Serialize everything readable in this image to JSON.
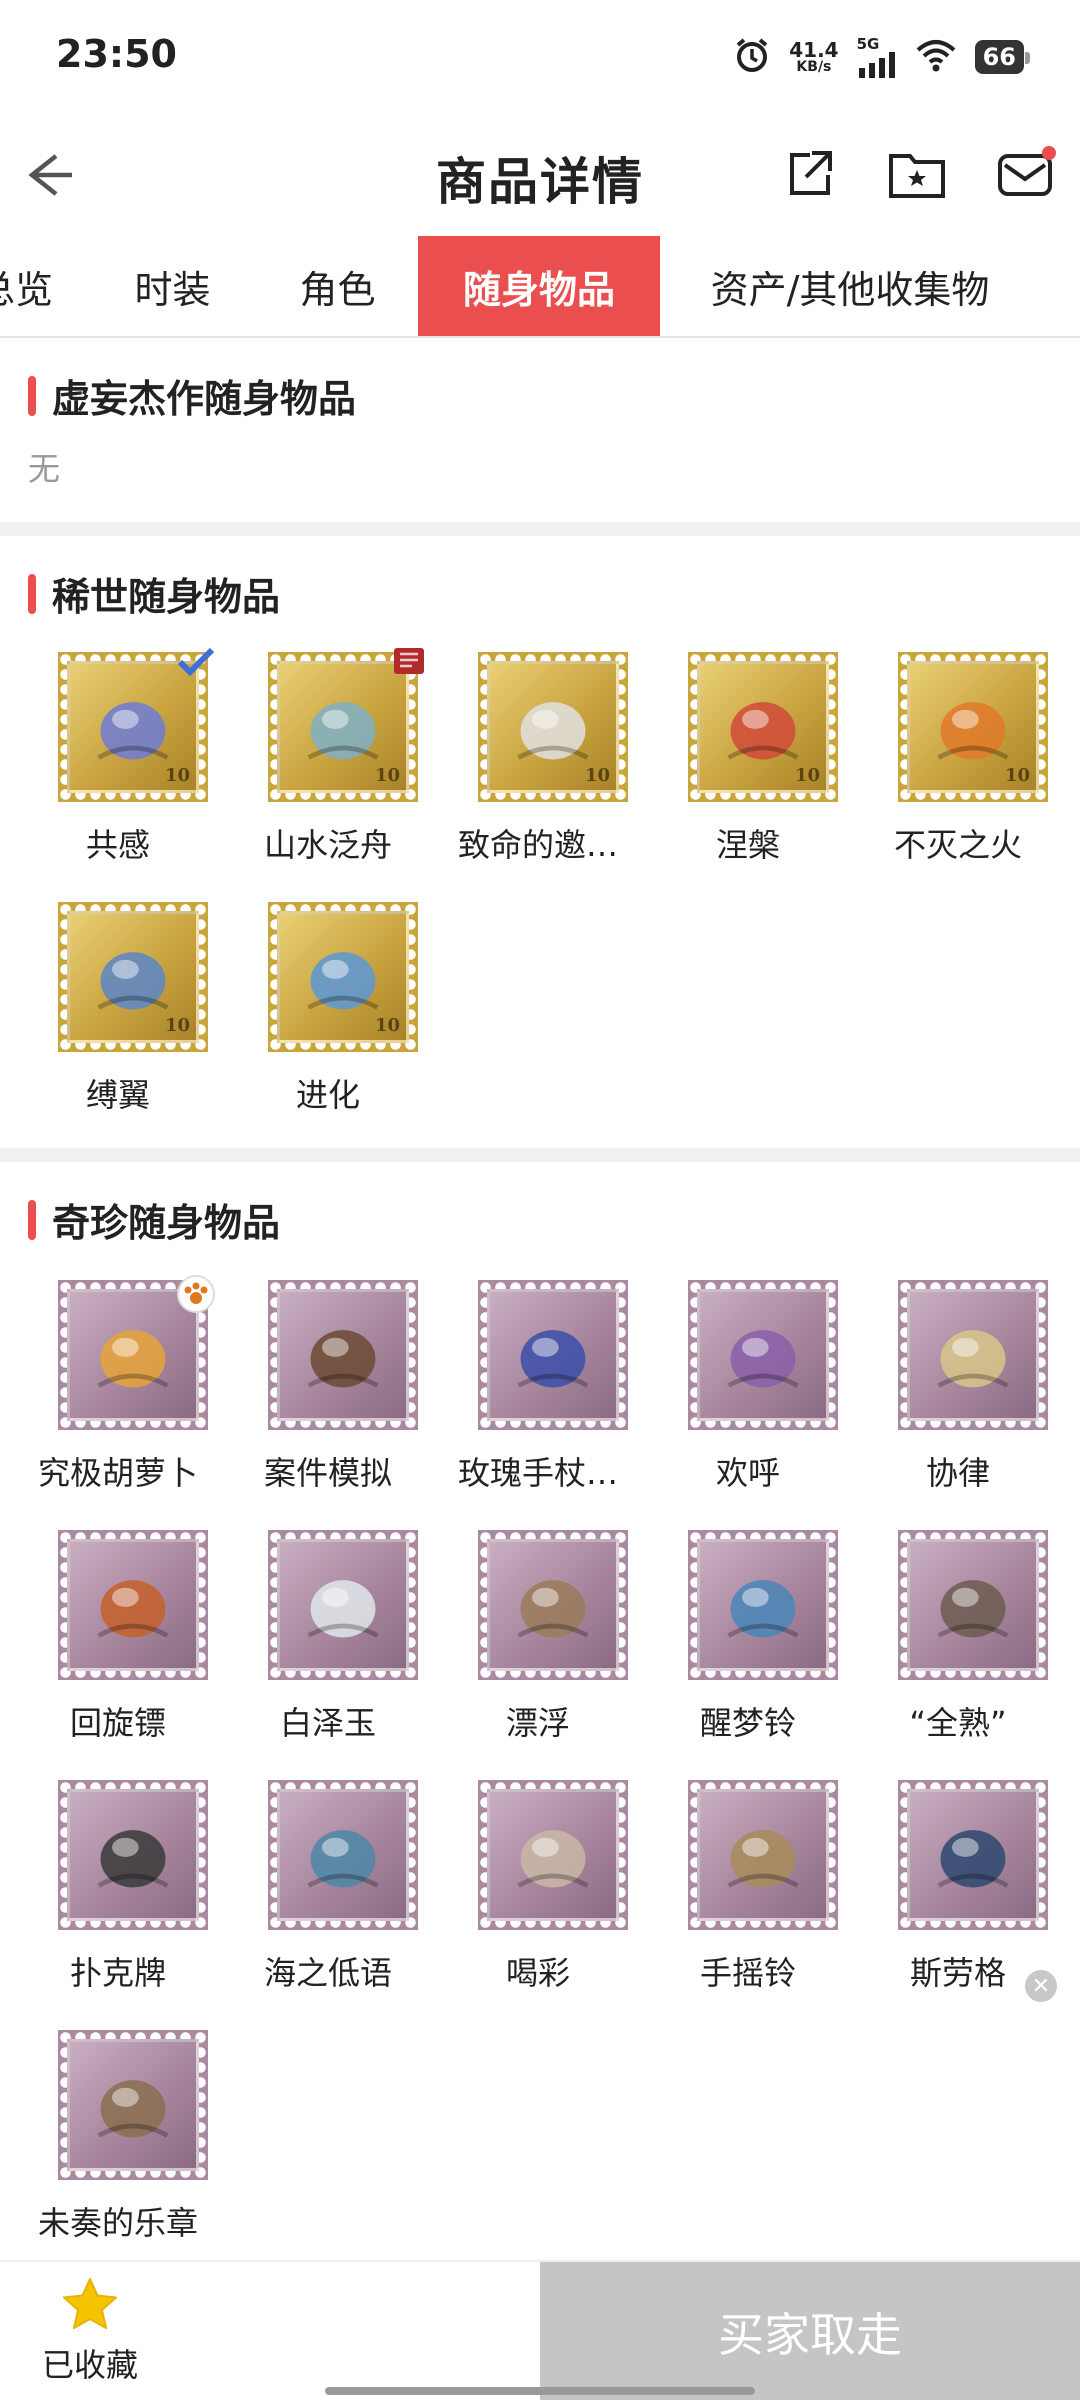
{
  "status": {
    "time": "23:50",
    "net_speed_value": "41.4",
    "net_speed_unit": "KB/s",
    "network": "5G",
    "battery": "66",
    "icons": [
      "alarm-icon",
      "signal-icon",
      "wifi-icon",
      "battery-icon"
    ]
  },
  "header": {
    "title": "商品详情",
    "icons": [
      "back-arrow-icon",
      "share-icon",
      "folder-star-icon",
      "mail-icon"
    ]
  },
  "tabs": [
    {
      "label": "总览",
      "active": false
    },
    {
      "label": "时装",
      "active": false
    },
    {
      "label": "角色",
      "active": false
    },
    {
      "label": "随身物品",
      "active": true
    },
    {
      "label": "资产/其他收集物",
      "active": false
    }
  ],
  "sections": {
    "s1": {
      "title": "虚妄杰作随身物品",
      "empty_text": "无"
    },
    "s2": {
      "title": "稀世随身物品",
      "stamp_value": "10",
      "items": [
        {
          "label": "共感",
          "badge": "check-badge-icon"
        },
        {
          "label": "山水泛舟",
          "badge": "book-badge-icon"
        },
        {
          "label": "致命的邀…"
        },
        {
          "label": "涅槃"
        },
        {
          "label": "不灭之火"
        },
        {
          "label": "缚翼"
        },
        {
          "label": "进化"
        }
      ]
    },
    "s3": {
      "title": "奇珍随身物品",
      "items": [
        {
          "label": "究极胡萝卜",
          "badge": "paw-badge-icon"
        },
        {
          "label": "案件模拟"
        },
        {
          "label": "玫瑰手杖…"
        },
        {
          "label": "欢呼"
        },
        {
          "label": "协律"
        },
        {
          "label": "回旋镖"
        },
        {
          "label": "白泽玉"
        },
        {
          "label": "漂浮"
        },
        {
          "label": "醒梦铃"
        },
        {
          "label": "“全熟”"
        },
        {
          "label": "扑克牌"
        },
        {
          "label": "海之低语"
        },
        {
          "label": "喝彩"
        },
        {
          "label": "手摇铃"
        },
        {
          "label": "斯劳格"
        },
        {
          "label": "未奏的乐章"
        }
      ]
    }
  },
  "bottom": {
    "fav_label": "已收藏",
    "buy_label": "买家取走"
  },
  "colors": {
    "accent": "#ea4e4e",
    "gold_stamp": "#c9a63b",
    "purple_stamp": "#a98a9f",
    "buy_disabled": "#c5c5c5",
    "star": "#f5c400"
  }
}
